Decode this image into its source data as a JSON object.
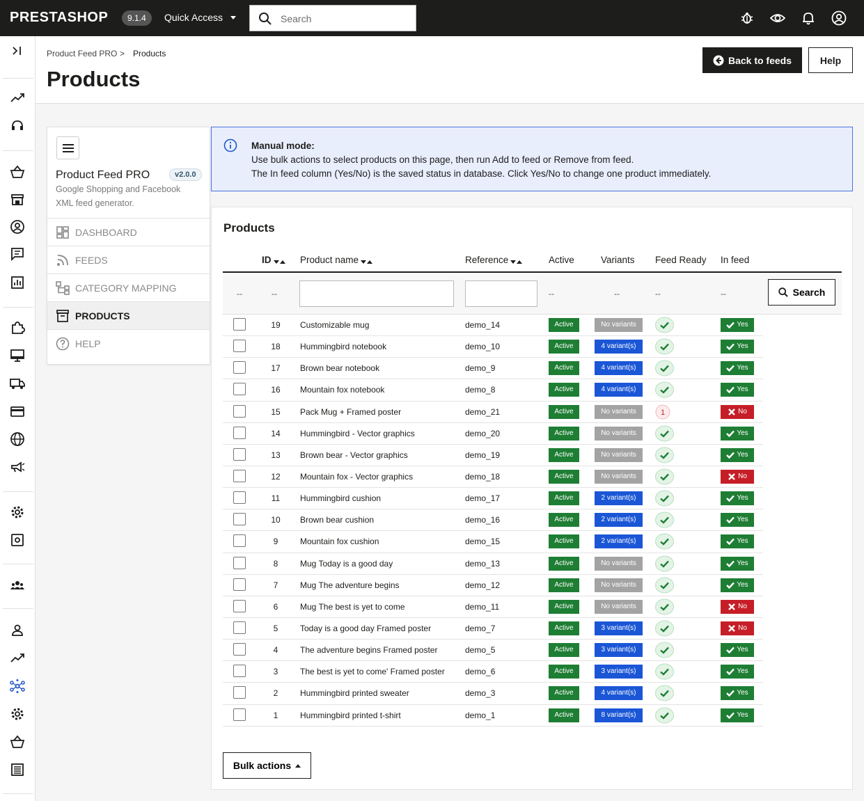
{
  "topbar": {
    "logo": "PRESTASHOP",
    "version": "9.1.4",
    "quick_access": "Quick Access",
    "search_placeholder": "Search"
  },
  "breadcrumb": {
    "parent": "Product Feed PRO",
    "separator": ">",
    "current": "Products"
  },
  "page": {
    "title": "Products",
    "back_label": "Back to feeds",
    "help_label": "Help"
  },
  "module": {
    "title": "Product Feed PRO",
    "version": "v2.0.0",
    "description": "Google Shopping and Facebook XML feed generator.",
    "nav": [
      {
        "label": "DASHBOARD",
        "icon": "dashboard-icon"
      },
      {
        "label": "FEEDS",
        "icon": "rss-icon"
      },
      {
        "label": "CATEGORY MAPPING",
        "icon": "sitemap-icon"
      },
      {
        "label": "PRODUCTS",
        "icon": "archive-icon",
        "active": true
      },
      {
        "label": "HELP",
        "icon": "help-circle-icon"
      }
    ]
  },
  "alert": {
    "title": "Manual mode:",
    "line1": "Use bulk actions to select products on this page, then run Add to feed or Remove from feed.",
    "line2": "The In feed column (Yes/No) is the saved status in database. Click Yes/No to change one product immediately."
  },
  "table": {
    "title": "Products",
    "headers": {
      "id": "ID",
      "name": "Product name",
      "reference": "Reference",
      "active": "Active",
      "variants": "Variants",
      "feed_ready": "Feed Ready",
      "in_feed": "In feed"
    },
    "filter_placeholder": "--",
    "search_label": "Search",
    "rows": [
      {
        "id": "19",
        "name": "Customizable mug",
        "ref": "demo_14",
        "active": "Active",
        "variants": "No variants",
        "feed_ready": "check",
        "in_feed": "Yes"
      },
      {
        "id": "18",
        "name": "Hummingbird notebook",
        "ref": "demo_10",
        "active": "Active",
        "variants": "4 variant(s)",
        "feed_ready": "check",
        "in_feed": "Yes"
      },
      {
        "id": "17",
        "name": "Brown bear notebook",
        "ref": "demo_9",
        "active": "Active",
        "variants": "4 variant(s)",
        "feed_ready": "check",
        "in_feed": "Yes"
      },
      {
        "id": "16",
        "name": "Mountain fox notebook",
        "ref": "demo_8",
        "active": "Active",
        "variants": "4 variant(s)",
        "feed_ready": "check",
        "in_feed": "Yes"
      },
      {
        "id": "15",
        "name": "Pack Mug + Framed poster",
        "ref": "demo_21",
        "active": "Active",
        "variants": "No variants",
        "feed_ready": "1",
        "in_feed": "No"
      },
      {
        "id": "14",
        "name": "Hummingbird - Vector graphics",
        "ref": "demo_20",
        "active": "Active",
        "variants": "No variants",
        "feed_ready": "check",
        "in_feed": "Yes"
      },
      {
        "id": "13",
        "name": "Brown bear - Vector graphics",
        "ref": "demo_19",
        "active": "Active",
        "variants": "No variants",
        "feed_ready": "check",
        "in_feed": "Yes"
      },
      {
        "id": "12",
        "name": "Mountain fox - Vector graphics",
        "ref": "demo_18",
        "active": "Active",
        "variants": "No variants",
        "feed_ready": "check",
        "in_feed": "No"
      },
      {
        "id": "11",
        "name": "Hummingbird cushion",
        "ref": "demo_17",
        "active": "Active",
        "variants": "2 variant(s)",
        "feed_ready": "check",
        "in_feed": "Yes"
      },
      {
        "id": "10",
        "name": "Brown bear cushion",
        "ref": "demo_16",
        "active": "Active",
        "variants": "2 variant(s)",
        "feed_ready": "check",
        "in_feed": "Yes"
      },
      {
        "id": "9",
        "name": "Mountain fox cushion",
        "ref": "demo_15",
        "active": "Active",
        "variants": "2 variant(s)",
        "feed_ready": "check",
        "in_feed": "Yes"
      },
      {
        "id": "8",
        "name": "Mug Today is a good day",
        "ref": "demo_13",
        "active": "Active",
        "variants": "No variants",
        "feed_ready": "check",
        "in_feed": "Yes"
      },
      {
        "id": "7",
        "name": "Mug The adventure begins",
        "ref": "demo_12",
        "active": "Active",
        "variants": "No variants",
        "feed_ready": "check",
        "in_feed": "Yes"
      },
      {
        "id": "6",
        "name": "Mug The best is yet to come",
        "ref": "demo_11",
        "active": "Active",
        "variants": "No variants",
        "feed_ready": "check",
        "in_feed": "No"
      },
      {
        "id": "5",
        "name": "Today is a good day Framed poster",
        "ref": "demo_7",
        "active": "Active",
        "variants": "3 variant(s)",
        "feed_ready": "check",
        "in_feed": "No"
      },
      {
        "id": "4",
        "name": "The adventure begins Framed poster",
        "ref": "demo_5",
        "active": "Active",
        "variants": "3 variant(s)",
        "feed_ready": "check",
        "in_feed": "Yes"
      },
      {
        "id": "3",
        "name": "The best is yet to come' Framed poster",
        "ref": "demo_6",
        "active": "Active",
        "variants": "3 variant(s)",
        "feed_ready": "check",
        "in_feed": "Yes"
      },
      {
        "id": "2",
        "name": "Hummingbird printed sweater",
        "ref": "demo_3",
        "active": "Active",
        "variants": "4 variant(s)",
        "feed_ready": "check",
        "in_feed": "Yes"
      },
      {
        "id": "1",
        "name": "Hummingbird printed t-shirt",
        "ref": "demo_1",
        "active": "Active",
        "variants": "8 variant(s)",
        "feed_ready": "check",
        "in_feed": "Yes"
      }
    ],
    "bulk_label": "Bulk actions"
  },
  "colors": {
    "dark": "#1d1d1b",
    "success": "#1e7e34",
    "danger": "#c61e27",
    "info": "#1a56d6",
    "muted": "#a3a3a3",
    "alert_bg": "#e8eefc",
    "alert_border": "#4a74e3"
  }
}
